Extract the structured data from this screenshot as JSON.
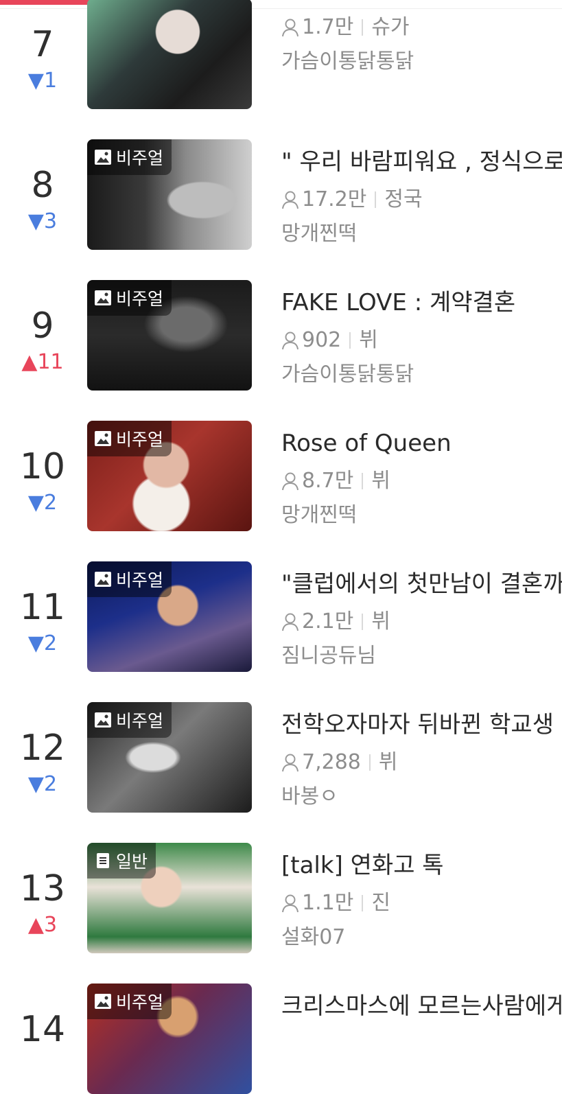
{
  "progress": {
    "fraction": 0.33,
    "color": "#e8455a"
  },
  "items": [
    {
      "rank": "7",
      "change": "▼1",
      "direction": "down",
      "badge": "",
      "badge_icon": "",
      "title": "",
      "views": "1.7만",
      "character": "슈가",
      "author": "가슴이통닭통닭"
    },
    {
      "rank": "8",
      "change": "▼3",
      "direction": "down",
      "badge": "비주얼",
      "badge_icon": "image-icon",
      "title": "\" 우리 바람피워요 , 정식으로",
      "views": "17.2만",
      "character": "정국",
      "author": "망개찐떡"
    },
    {
      "rank": "9",
      "change": "▲11",
      "direction": "up",
      "badge": "비주얼",
      "badge_icon": "image-icon",
      "title": "FAKE LOVE : 계약결혼",
      "views": "902",
      "character": "뷔",
      "author": "가슴이통닭통닭"
    },
    {
      "rank": "10",
      "change": "▼2",
      "direction": "down",
      "badge": "비주얼",
      "badge_icon": "image-icon",
      "title": "Rose of Queen",
      "views": "8.7만",
      "character": "뷔",
      "author": "망개찐떡"
    },
    {
      "rank": "11",
      "change": "▼2",
      "direction": "down",
      "badge": "비주얼",
      "badge_icon": "image-icon",
      "title": "\"클럽에서의 첫만남이 결혼까",
      "views": "2.1만",
      "character": "뷔",
      "author": "짐니공듀님"
    },
    {
      "rank": "12",
      "change": "▼2",
      "direction": "down",
      "badge": "비주얼",
      "badge_icon": "image-icon",
      "title": "전학오자마자 뒤바뀐 학교생",
      "views": "7,288",
      "character": "뷔",
      "author": "바봉ㅇ"
    },
    {
      "rank": "13",
      "change": "▲3",
      "direction": "up",
      "badge": "일반",
      "badge_icon": "document-icon",
      "title": "[talk] 연화고 톡",
      "views": "1.1만",
      "character": "진",
      "author": "설화07"
    },
    {
      "rank": "14",
      "change": "",
      "direction": "",
      "badge": "비주얼",
      "badge_icon": "image-icon",
      "title": "크리스마스에 모르는사람에게",
      "views": "",
      "character": "",
      "author": ""
    }
  ]
}
